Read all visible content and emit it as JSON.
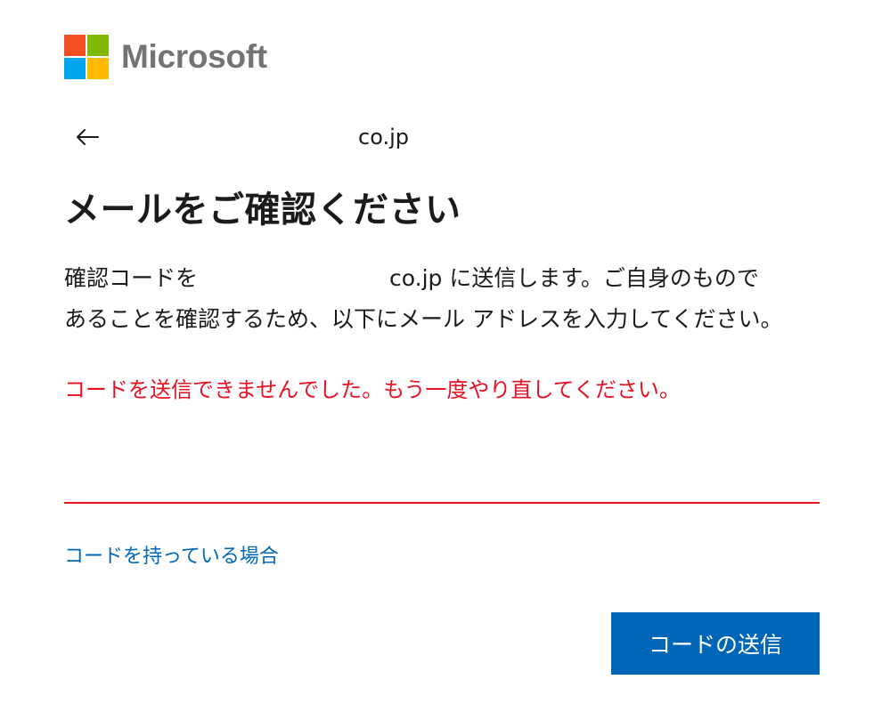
{
  "brand": {
    "name": "Microsoft",
    "logo_colors": [
      "#f25022",
      "#7fba00",
      "#00a4ef",
      "#ffb900"
    ],
    "text_color": "#737373"
  },
  "identity": {
    "back_icon": "back-arrow-icon",
    "text": "co.jp"
  },
  "title": "メールをご確認ください",
  "description": {
    "line1_start": "確認コードを",
    "line1_end": "co.jp に送信します。ご自身のもので",
    "line2": "あることを確認するため、以下にメール アドレスを入力してください。"
  },
  "error_message": "コードを送信できませんでした。もう一度やり直してください。",
  "email_input": {
    "value": "",
    "placeholder": ""
  },
  "have_code_link": "コードを持っている場合",
  "send_button": "コードの送信",
  "colors": {
    "accent": "#0067b8",
    "error": "#e81123",
    "text": "#1b1b1b"
  }
}
